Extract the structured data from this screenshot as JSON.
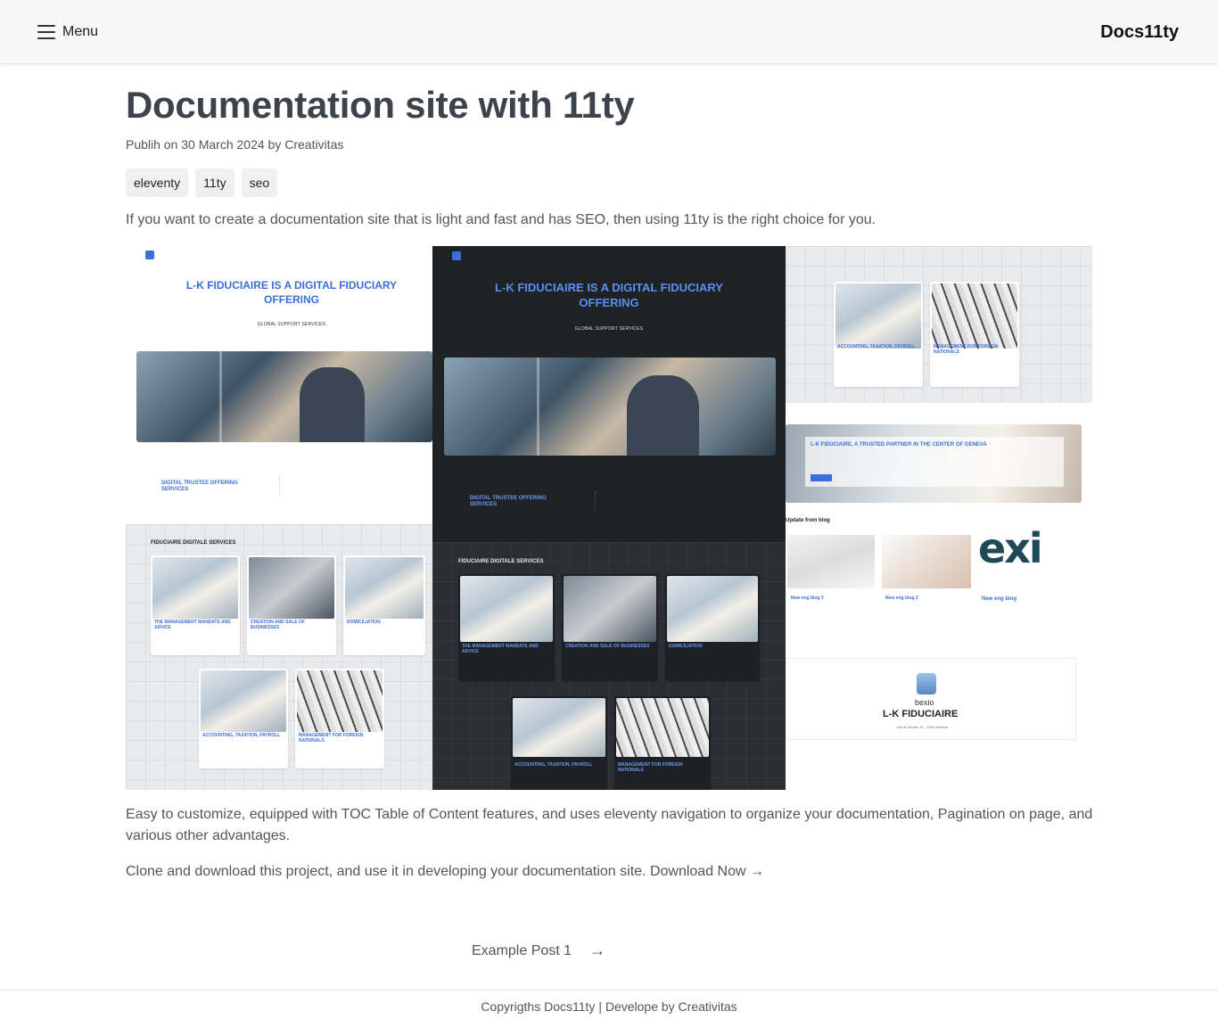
{
  "header": {
    "menu_label": "Menu",
    "brand": "Docs11ty"
  },
  "post": {
    "title": "Documentation site with 11ty",
    "meta": "Publih on 30 March 2024 by Creativitas",
    "tags": [
      "eleventy",
      "11ty",
      "seo"
    ],
    "intro": "If you want to create a documentation site that is light and fast and has SEO, then using 11ty is the right choice for you.",
    "paragraph_features": "Easy to customize, equipped with TOC Table of Content features, and uses eleventy navigation to organize your documentation, Pagination on page, and various other advantages.",
    "paragraph_clone": "Clone and download this project, and use it in developing your documentation site.",
    "download_link": "Download Now →"
  },
  "showcase": {
    "hero_heading": "L-K FIDUCIAIRE IS A DIGITAL FIDUCIARY OFFERING",
    "hero_sub": "GLOBAL SUPPORT SERVICES",
    "digital_trustee": "DIGITAL TRUSTEE OFFERING SERVICES",
    "services_heading": "FIDUCIAIRE DIGITALE SERVICES",
    "card_mandate": "THE MANAGEMENT MANDATE AND ADVICE",
    "card_creation": "CREATION AND SALE OF BUSINESSES",
    "card_domiciliation": "DOMICILIATION",
    "card_accounting": "ACCOUNTING, TAXATION, PAYROLL",
    "card_foreign": "MANAGEMENT FOR FOREIGN NATIONALS",
    "trusted_partner": "L-K FIDUCIAIRE, A TRUSTED PARTNER IN THE CENTER OF GENEVA",
    "blog_heading": "Update from blog",
    "blog_1": "New eng blog 3",
    "blog_2": "New eng blog 2",
    "blog_3": "New eng blog",
    "exi_text": "exi",
    "bexio": "bexio",
    "lk_name": "L-K FIDUCIAIRE",
    "address": "rue du Rhône 11 - 1204 Genève"
  },
  "pager": {
    "next_label": "Example Post 1",
    "next_arrow": "→"
  },
  "footer": {
    "text": "Copyrigths Docs11ty | Develope by Creativitas"
  }
}
